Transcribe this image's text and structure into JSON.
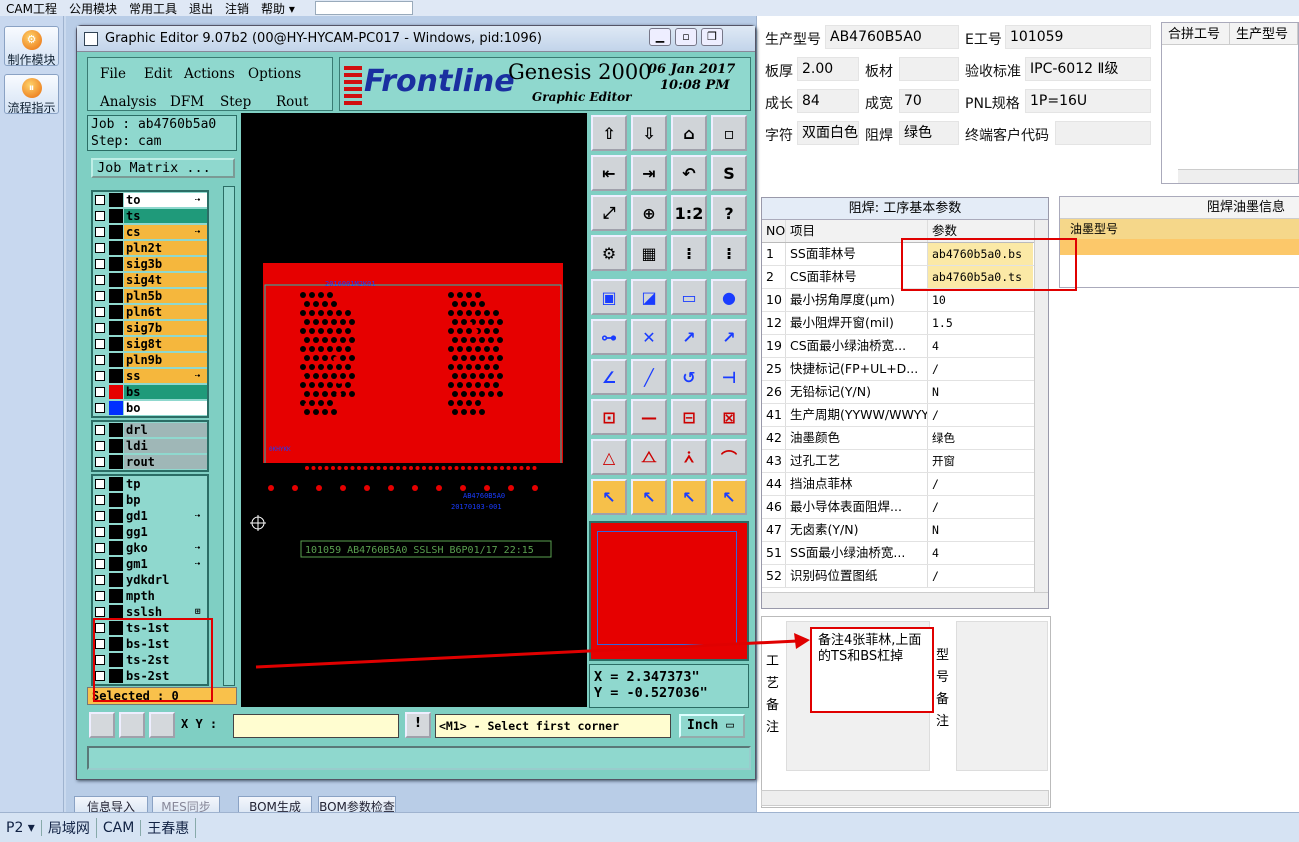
{
  "app_menu": {
    "items": [
      "CAM工程",
      "公用模块",
      "常用工具",
      "退出",
      "注销",
      "帮助"
    ]
  },
  "left_nav": {
    "items": [
      {
        "label": "制作模块"
      },
      {
        "label": "流程指示"
      }
    ]
  },
  "under_buttons": [
    "信息导入",
    "MES同步",
    "BOM生成",
    "BOM参数检查"
  ],
  "editor": {
    "title": "Graphic Editor 9.07b2 (00@HY-HYCAM-PC017 - Windows, pid:1096)",
    "menu": [
      "File",
      "Edit",
      "Actions",
      "Options",
      "Analysis",
      "DFM",
      "Step",
      "Rout"
    ],
    "logo_brand": "Frontline",
    "logo_product": "Genesis 2000",
    "logo_sub": "Graphic Editor",
    "date": "06 Jan 2017",
    "time": "10:08 PM",
    "job": "Job : ab4760b5a0",
    "step": "Step: cam",
    "job_matrix": "Job Matrix ...",
    "selected": "Selected : 0",
    "coord_x": "X = 2.347373\"",
    "coord_y": "Y = -0.527036\"",
    "xy_label": "X Y :",
    "message": "<M1> - Select first corner",
    "unit": "Inch",
    "canvas_text1": "2016001M2K01",
    "canvas_text2": "AB4760B5A0",
    "canvas_text3": "20170103-001",
    "canvas_text4": "0KHYKK",
    "canvas_text5": "101059 AB4760B5A0 SSLSH B6P01/17 22:15",
    "layers_g1": [
      {
        "name": "to",
        "color": "#ffffff",
        "sw": "#000000",
        "mark": "⇢"
      },
      {
        "name": "ts",
        "color": "#1f9a7a",
        "sw": "#000000",
        "mark": ""
      },
      {
        "name": "cs",
        "color": "#f5b73d",
        "sw": "#000000",
        "mark": "⇢"
      },
      {
        "name": "pln2t",
        "color": "#f5b73d",
        "sw": "#000000",
        "mark": ""
      },
      {
        "name": "sig3b",
        "color": "#f5b73d",
        "sw": "#000000",
        "mark": ""
      },
      {
        "name": "sig4t",
        "color": "#f5b73d",
        "sw": "#000000",
        "mark": ""
      },
      {
        "name": "pln5b",
        "color": "#f5b73d",
        "sw": "#000000",
        "mark": ""
      },
      {
        "name": "pln6t",
        "color": "#f5b73d",
        "sw": "#000000",
        "mark": ""
      },
      {
        "name": "sig7b",
        "color": "#f5b73d",
        "sw": "#000000",
        "mark": ""
      },
      {
        "name": "sig8t",
        "color": "#f5b73d",
        "sw": "#000000",
        "mark": ""
      },
      {
        "name": "pln9b",
        "color": "#f5b73d",
        "sw": "#000000",
        "mark": ""
      },
      {
        "name": "ss",
        "color": "#f5b73d",
        "sw": "#000000",
        "mark": "⇢"
      },
      {
        "name": "bs",
        "color": "#1f9a7a",
        "sw": "#e60000",
        "mark": ""
      },
      {
        "name": "bo",
        "color": "#ffffff",
        "sw": "#0030ff",
        "mark": ""
      }
    ],
    "layers_g2": [
      {
        "name": "drl",
        "color": "#9fb7b7"
      },
      {
        "name": "ldi",
        "color": "#9fb7b7"
      },
      {
        "name": "rout",
        "color": "#9fb7b7"
      }
    ],
    "layers_g3": [
      {
        "name": "tp",
        "color": "#8fd8ce",
        "mark": ""
      },
      {
        "name": "bp",
        "color": "#8fd8ce",
        "mark": ""
      },
      {
        "name": "gd1",
        "color": "#8fd8ce",
        "mark": "⇢"
      },
      {
        "name": "gg1",
        "color": "#8fd8ce",
        "mark": ""
      },
      {
        "name": "gko",
        "color": "#8fd8ce",
        "mark": "⇢"
      },
      {
        "name": "gm1",
        "color": "#8fd8ce",
        "mark": "⇢"
      },
      {
        "name": "ydkdrl",
        "color": "#8fd8ce",
        "mark": ""
      },
      {
        "name": "mpth",
        "color": "#8fd8ce",
        "mark": ""
      },
      {
        "name": "sslsh",
        "color": "#8fd8ce",
        "mark": "⊞"
      },
      {
        "name": "ts-1st",
        "color": "#8fd8ce",
        "mark": ""
      },
      {
        "name": "bs-1st",
        "color": "#8fd8ce",
        "mark": ""
      },
      {
        "name": "ts-2st",
        "color": "#8fd8ce",
        "mark": ""
      },
      {
        "name": "bs-2st",
        "color": "#8fd8ce",
        "mark": ""
      }
    ],
    "tool_icons": [
      "⇧",
      "⇩",
      "⌂",
      "▫",
      "⇤",
      "⇥",
      "↶",
      "S",
      "⤢",
      "⊕",
      "1:2",
      "?",
      "⚙",
      "▦",
      "⁝",
      "⁝",
      "▣",
      "◪",
      "▭",
      "●",
      "⊶",
      "✕",
      "↗",
      "↗",
      "∠",
      "╱",
      "↺",
      "⊣",
      "⊡",
      "—",
      "⊟",
      "⊠",
      "△",
      "⧍",
      "⩑",
      "⌒",
      "↖",
      "↖",
      "↖",
      "↖"
    ]
  },
  "product": {
    "fields": [
      {
        "label": "生产型号",
        "value": "AB4760B5A0"
      },
      {
        "label": "E工号",
        "value": "101059"
      },
      {
        "label": "板厚",
        "value": "2.00"
      },
      {
        "label": "板材",
        "value": ""
      },
      {
        "label": "验收标准",
        "value": "IPC-6012 Ⅱ级"
      },
      {
        "label": "成长",
        "value": "84"
      },
      {
        "label": "成宽",
        "value": "70"
      },
      {
        "label": "PNL规格",
        "value": "1P=16U"
      },
      {
        "label": "字符",
        "value": "双面白色"
      },
      {
        "label": "阻焊",
        "value": "绿色"
      },
      {
        "label": "终端客户代码",
        "value": ""
      }
    ],
    "merge_headers": [
      "合拼工号",
      "生产型号"
    ]
  },
  "grid1": {
    "caption": "阻焊: 工序基本参数",
    "headers": [
      "NO",
      "项目",
      "参数"
    ],
    "rows": [
      [
        "1",
        "SS面菲林号",
        "ab4760b5a0.bs"
      ],
      [
        "2",
        "CS面菲林号",
        "ab4760b5a0.ts"
      ],
      [
        "10",
        "最小拐角厚度(μm)",
        "10"
      ],
      [
        "12",
        "最小阻焊开窗(mil)",
        "1.5"
      ],
      [
        "19",
        "CS面最小绿油桥宽...",
        "4"
      ],
      [
        "25",
        "快捷标记(FP+UL+D...",
        "/"
      ],
      [
        "26",
        "无铅标记(Y/N)",
        "N"
      ],
      [
        "41",
        "生产周期(YYWW/WWYY)",
        "/"
      ],
      [
        "42",
        "油墨颜色",
        "绿色"
      ],
      [
        "43",
        "过孔工艺",
        "开窗"
      ],
      [
        "44",
        "挡油点菲林",
        "/"
      ],
      [
        "46",
        "最小导体表面阻焊...",
        "/"
      ],
      [
        "47",
        "无卤素(Y/N)",
        "N"
      ],
      [
        "51",
        "SS面最小绿油桥宽...",
        "4"
      ],
      [
        "52",
        "识别码位置图纸",
        "/"
      ]
    ]
  },
  "grid2": {
    "caption": "阻焊油墨信息",
    "header": "油墨型号"
  },
  "remarks": {
    "left": "工艺备注",
    "right": "型号备注"
  },
  "annotation": {
    "callout": "备注4张菲林,上面的TS和BS杠掉"
  },
  "status": {
    "items": [
      "P2",
      "局域网",
      "CAM",
      "王春惠"
    ]
  }
}
